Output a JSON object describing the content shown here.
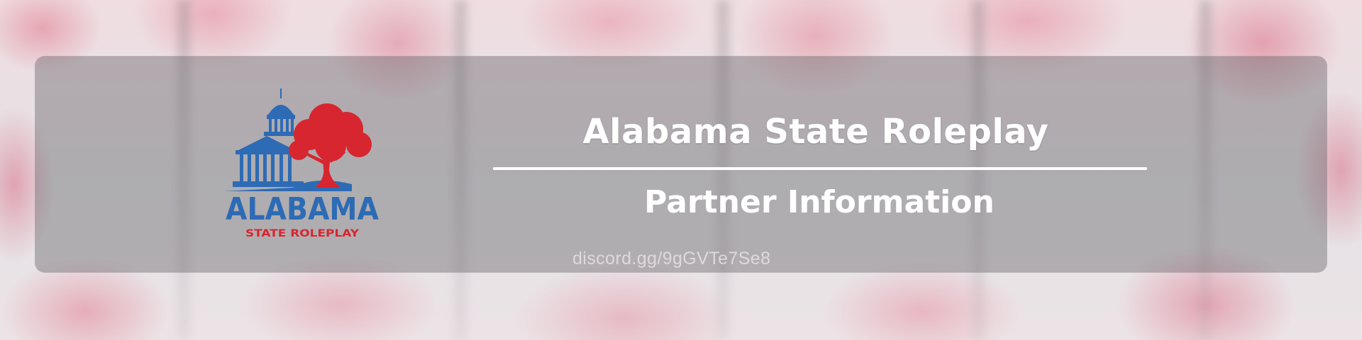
{
  "banner": {
    "title": "Alabama State Roleplay",
    "subtitle": "Partner Information",
    "invite_link": "discord.gg/9gGVTe7Se8"
  },
  "logo": {
    "name": "ALABAMA",
    "tagline": "STATE ROLEPLAY",
    "icons": [
      "capitol-building-icon",
      "oak-tree-icon"
    ]
  },
  "colors": {
    "logo_blue": "#2d6bb5",
    "logo_red": "#d7262f",
    "text_white": "#ffffff",
    "card_overlay": "rgba(100,98,102,0.42)",
    "background_blossom": "#e6a3b1"
  }
}
